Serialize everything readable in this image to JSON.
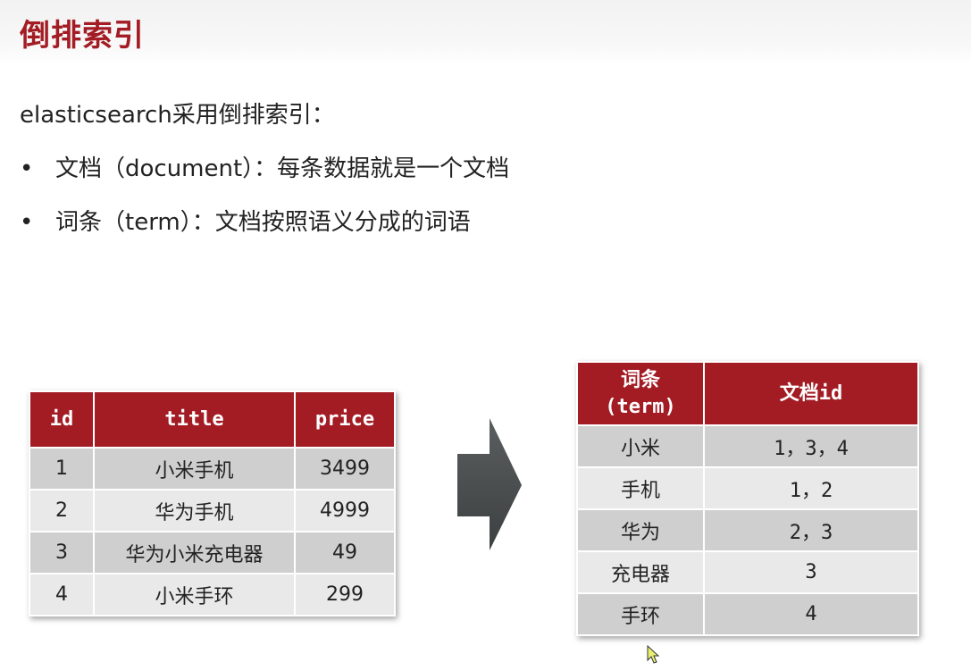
{
  "slide": {
    "title": "倒排索引",
    "intro": "elasticsearch采用倒排索引：",
    "bullets": [
      "文档（document）：每条数据就是一个文档",
      "词条（term）：文档按照语义分成的词语"
    ]
  },
  "doc_table": {
    "headers": [
      "id",
      "title",
      "price"
    ],
    "rows": [
      [
        "1",
        "小米手机",
        "3499"
      ],
      [
        "2",
        "华为手机",
        "4999"
      ],
      [
        "3",
        "华为小米充电器",
        "49"
      ],
      [
        "4",
        "小米手环",
        "299"
      ]
    ]
  },
  "term_table": {
    "headers": [
      "词条",
      "(term)",
      "文档id"
    ],
    "rows": [
      [
        "小米",
        "1，3，4"
      ],
      [
        "手机",
        "1，2"
      ],
      [
        "华为",
        "2，3"
      ],
      [
        "充电器",
        "3"
      ],
      [
        "手环",
        "4"
      ]
    ]
  },
  "colors": {
    "accent": "#a31c24",
    "row_dark": "#cfcfcf",
    "row_light": "#e9e9e9",
    "arrow": "#4a4d4d"
  },
  "icons": {
    "arrow": "right-arrow-icon",
    "cursor": "mouse-cursor-icon"
  }
}
